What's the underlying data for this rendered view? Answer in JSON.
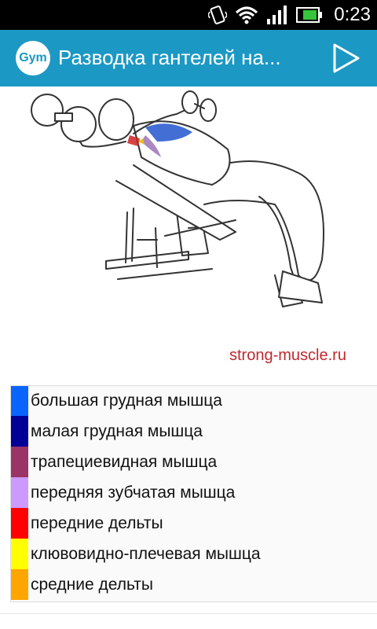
{
  "status_bar": {
    "time": "0:23",
    "icons": [
      "vibrate-icon",
      "wifi-icon",
      "signal-icon",
      "battery-icon"
    ]
  },
  "app_bar": {
    "logo_text": "Gym",
    "title": "Разводка гантелей на...",
    "play_icon": "play-icon",
    "color": "#1c98c4"
  },
  "illustration": {
    "watermark": "strong-muscle.ru"
  },
  "legend": {
    "items": [
      {
        "label": "большая грудная мышца",
        "color": "#0a64ff"
      },
      {
        "label": "малая грудная мышца",
        "color": "#000096"
      },
      {
        "label": "трапециевидная мышца",
        "color": "#9a3366"
      },
      {
        "label": "передняя зубчатая мышца",
        "color": "#cc99ff"
      },
      {
        "label": "передние дельты",
        "color": "#ff0000"
      },
      {
        "label": "клювовидно-плечевая мышца",
        "color": "#ffff00"
      },
      {
        "label": "средние дельты",
        "color": "#ffa500"
      }
    ]
  }
}
